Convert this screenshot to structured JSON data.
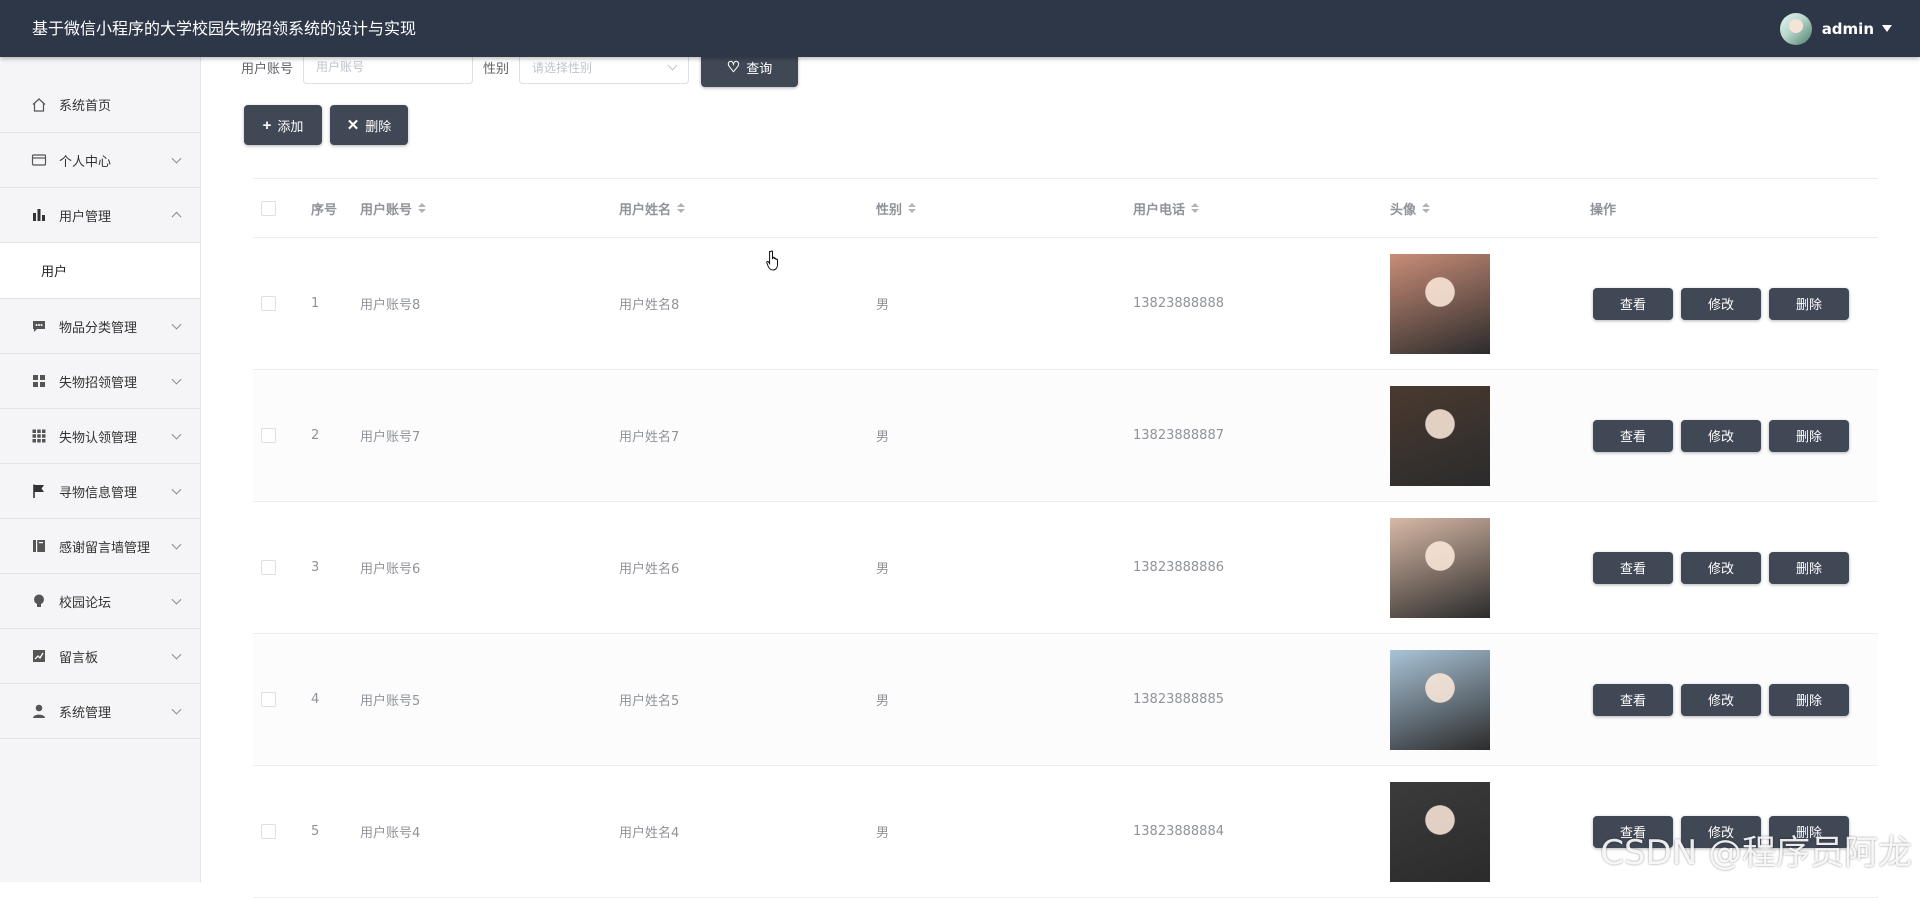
{
  "header": {
    "title": "基于微信小程序的大学校园失物招领系统的设计与实现",
    "user": "admin"
  },
  "sidebar": {
    "items": [
      {
        "label": "系统首页",
        "icon": "home-icon"
      },
      {
        "label": "个人中心",
        "icon": "card-icon"
      },
      {
        "label": "用户管理",
        "icon": "bar-chart-icon"
      },
      {
        "label": "物品分类管理",
        "icon": "chat-icon"
      },
      {
        "label": "失物招领管理",
        "icon": "grid-icon"
      },
      {
        "label": "失物认领管理",
        "icon": "apps-icon"
      },
      {
        "label": "寻物信息管理",
        "icon": "flag-icon"
      },
      {
        "label": "感谢留言墙管理",
        "icon": "notebook-icon"
      },
      {
        "label": "校园论坛",
        "icon": "bulb-icon"
      },
      {
        "label": "留言板",
        "icon": "chart-line-icon"
      },
      {
        "label": "系统管理",
        "icon": "user-icon"
      }
    ],
    "sub_item": "用户"
  },
  "search": {
    "account_label": "用户账号",
    "account_placeholder": "用户账号",
    "gender_label": "性别",
    "gender_placeholder": "请选择性别",
    "query_label": "查询"
  },
  "toolbar": {
    "add_label": "添加",
    "delete_label": "删除"
  },
  "table": {
    "headers": {
      "index": "序号",
      "account": "用户账号",
      "name": "用户姓名",
      "gender": "性别",
      "phone": "用户电话",
      "avatar": "头像",
      "actions": "操作"
    },
    "rows": [
      {
        "index": "1",
        "account": "用户账号8",
        "name": "用户姓名8",
        "gender": "男",
        "phone": "13823888888",
        "photo_color": "#c98d78"
      },
      {
        "index": "2",
        "account": "用户账号7",
        "name": "用户姓名7",
        "gender": "男",
        "phone": "13823888887",
        "photo_color": "#4a3a30"
      },
      {
        "index": "3",
        "account": "用户账号6",
        "name": "用户姓名6",
        "gender": "男",
        "phone": "13823888886",
        "photo_color": "#d8b9a6"
      },
      {
        "index": "4",
        "account": "用户账号5",
        "name": "用户姓名5",
        "gender": "男",
        "phone": "13823888885",
        "photo_color": "#a9c4d8"
      },
      {
        "index": "5",
        "account": "用户账号4",
        "name": "用户姓名4",
        "gender": "男",
        "phone": "13823888884",
        "photo_color": "#3b3b3b"
      }
    ],
    "actions": {
      "view": "查看",
      "edit": "修改",
      "delete": "删除"
    }
  },
  "watermark": "CSDN @程序员阿龙"
}
